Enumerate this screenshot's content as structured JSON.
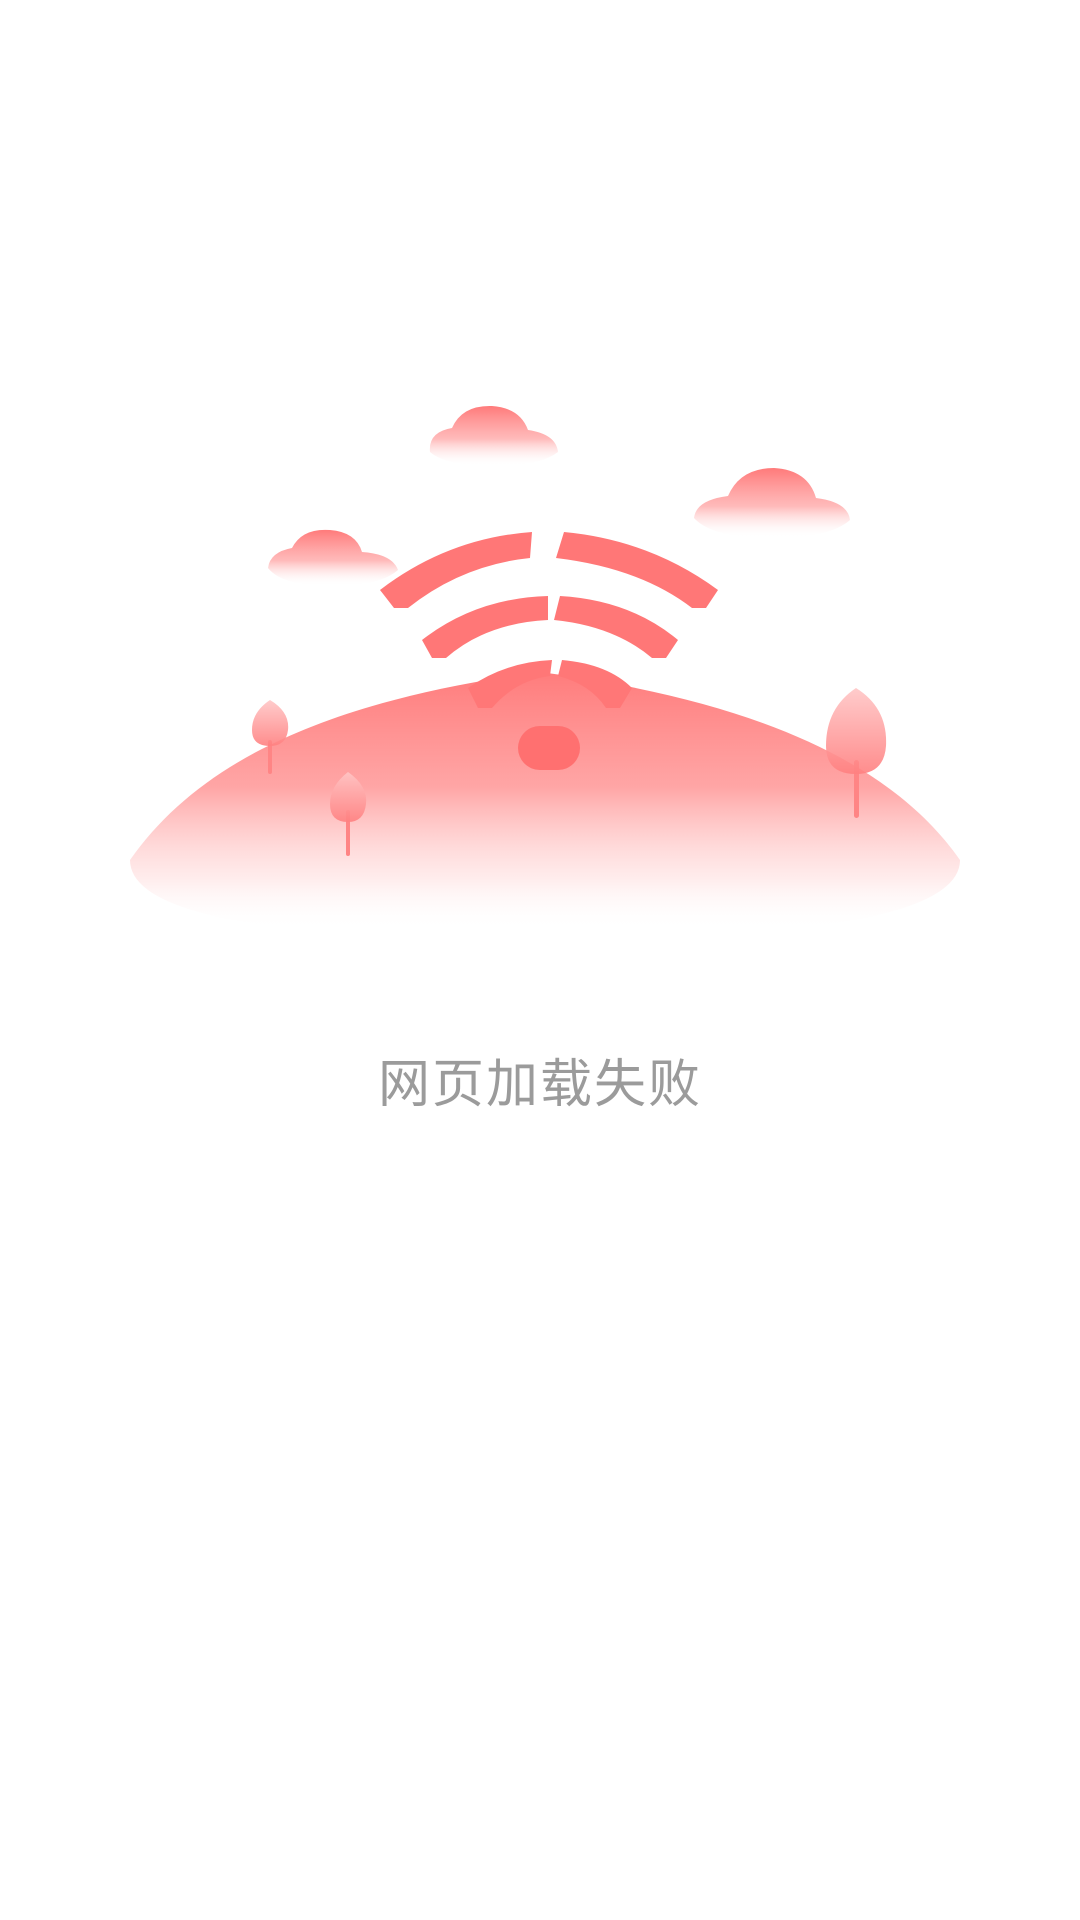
{
  "status": {
    "message": "网页加载失败"
  },
  "illustration": {
    "icon": "wifi-broken-icon",
    "colors": {
      "accent": "#ff7777",
      "hill": "#ff8585",
      "cloud": "#ff8080",
      "text": "#9b9b9b",
      "background": "#ffffff"
    }
  }
}
